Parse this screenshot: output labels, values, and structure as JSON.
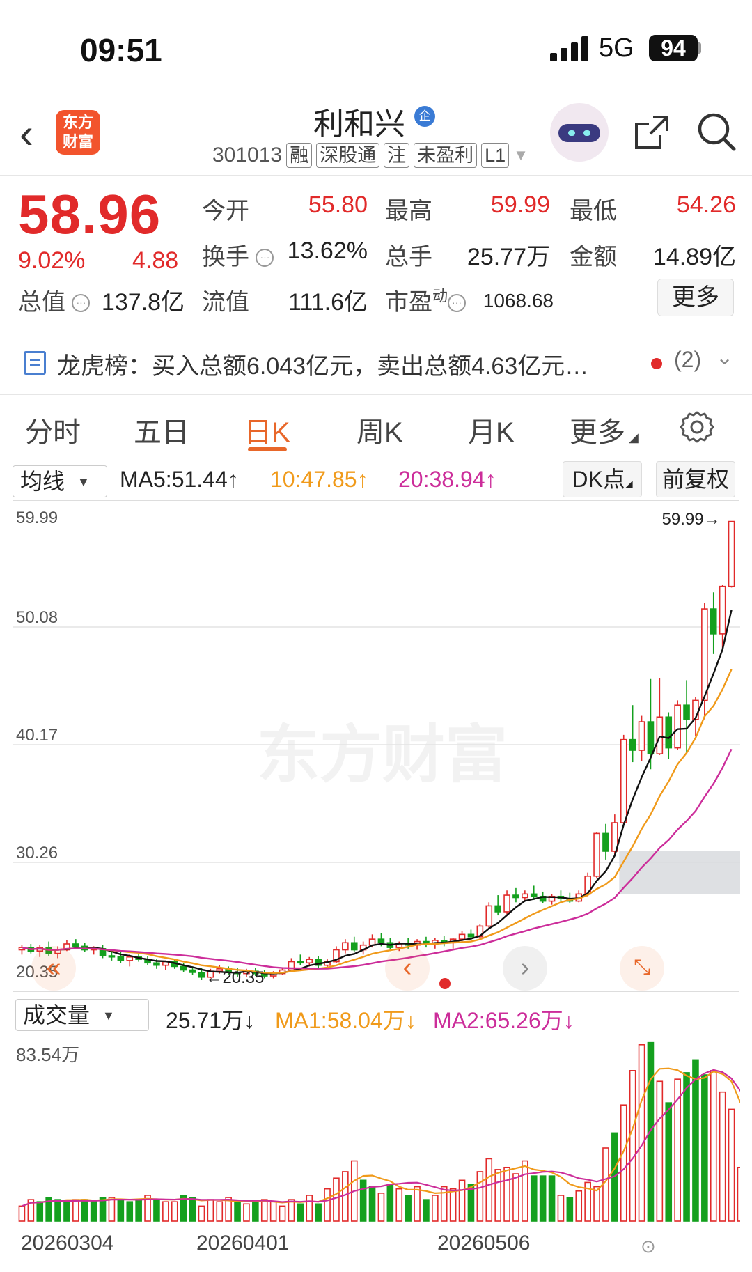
{
  "status_bar": {
    "time": "09:51",
    "network": "5G",
    "battery": "94"
  },
  "header": {
    "logo_text": "东方财富",
    "stock_name": "利和兴",
    "verified_badge": "企",
    "code": "301013",
    "tags": [
      "融",
      "深股通",
      "注",
      "未盈利",
      "L1"
    ]
  },
  "quote": {
    "price": "58.96",
    "change_pct": "9.02%",
    "change": "4.88",
    "open_label": "今开",
    "open": "55.80",
    "high_label": "最高",
    "high": "59.99",
    "low_label": "最低",
    "low": "54.26",
    "turnover_label": "换手",
    "turnover": "13.62%",
    "volume_label": "总手",
    "volume": "25.77万",
    "amount_label": "金额",
    "amount": "14.89亿",
    "mktcap_label": "总值",
    "mktcap": "137.8亿",
    "float_label": "流值",
    "float_cap": "111.6亿",
    "pe_label": "市盈",
    "pe_sup": "动",
    "pe": "1068.68",
    "more": "更多"
  },
  "dragon_tiger": {
    "text": "龙虎榜：买入总额6.043亿元，卖出总额4.63亿元…",
    "count": "(2)"
  },
  "tabs": [
    "分时",
    "五日",
    "日K",
    "周K",
    "月K",
    "更多"
  ],
  "active_tab": "日K",
  "ma_bar": {
    "selector": "均线",
    "ma5": "MA5:51.44↑",
    "ma10": "10:47.85↑",
    "ma20": "20:38.94↑",
    "dk_button": "DK点",
    "adjust_button": "前复权"
  },
  "colors": {
    "up": "#e12a2a",
    "down": "#14a01e",
    "ma5": "#111111",
    "ma10": "#f09a1a",
    "ma20": "#cc2d9a",
    "accent": "#e8672a"
  },
  "vol_bar": {
    "selector": "成交量",
    "value": "25.71万↓",
    "ma1": "MA1:58.04万↓",
    "ma2": "MA2:65.26万↓"
  },
  "watermark": "东方财富",
  "chart_data": {
    "type": "candlestick",
    "y_ticks": [
      "59.99",
      "50.08",
      "40.17",
      "30.26",
      "20.35"
    ],
    "ylim": [
      20.35,
      59.99
    ],
    "max_marker": "59.99→",
    "min_marker": "←20.35",
    "vol_max_label": "83.54万",
    "x_labels": [
      "20260304",
      "20260401",
      "20260506"
    ],
    "candles": [
      [
        22.9,
        23.3,
        22.5,
        23.1
      ],
      [
        23.1,
        23.4,
        22.6,
        22.8
      ],
      [
        22.8,
        23.3,
        22.3,
        23.1
      ],
      [
        23.1,
        23.6,
        22.4,
        22.6
      ],
      [
        22.6,
        23.2,
        22.2,
        22.9
      ],
      [
        22.9,
        23.7,
        22.8,
        23.4
      ],
      [
        23.4,
        23.8,
        23.0,
        23.2
      ],
      [
        23.2,
        23.5,
        22.7,
        22.9
      ],
      [
        22.9,
        23.2,
        22.5,
        23.0
      ],
      [
        23.0,
        23.3,
        22.2,
        22.4
      ],
      [
        22.4,
        22.8,
        22.0,
        22.3
      ],
      [
        22.3,
        22.7,
        21.8,
        22.0
      ],
      [
        22.0,
        22.5,
        21.5,
        22.3
      ],
      [
        22.3,
        22.6,
        21.9,
        22.1
      ],
      [
        22.1,
        22.4,
        21.6,
        21.8
      ],
      [
        21.8,
        22.1,
        21.3,
        21.6
      ],
      [
        21.6,
        22.0,
        21.2,
        21.9
      ],
      [
        21.9,
        22.1,
        21.3,
        21.5
      ],
      [
        21.5,
        21.8,
        21.0,
        21.2
      ],
      [
        21.2,
        21.5,
        20.8,
        21.0
      ],
      [
        21.0,
        21.4,
        20.35,
        20.6
      ],
      [
        20.6,
        21.3,
        20.5,
        21.1
      ],
      [
        21.1,
        21.6,
        20.9,
        21.3
      ],
      [
        21.3,
        21.5,
        20.8,
        21.0
      ],
      [
        21.0,
        21.4,
        20.6,
        20.9
      ],
      [
        20.9,
        21.3,
        20.6,
        21.1
      ],
      [
        21.1,
        21.4,
        20.7,
        20.9
      ],
      [
        20.9,
        21.2,
        20.5,
        20.7
      ],
      [
        20.7,
        21.1,
        20.5,
        20.9
      ],
      [
        20.9,
        21.4,
        20.8,
        21.2
      ],
      [
        21.2,
        22.2,
        21.1,
        21.9
      ],
      [
        21.9,
        22.5,
        21.6,
        21.8
      ],
      [
        21.8,
        22.3,
        21.5,
        22.1
      ],
      [
        22.1,
        22.4,
        21.4,
        21.6
      ],
      [
        21.6,
        22.1,
        21.3,
        21.9
      ],
      [
        21.9,
        23.2,
        21.8,
        22.9
      ],
      [
        22.9,
        23.8,
        22.6,
        23.5
      ],
      [
        23.5,
        24.0,
        22.7,
        22.9
      ],
      [
        22.9,
        23.6,
        22.5,
        23.3
      ],
      [
        23.3,
        24.2,
        23.1,
        23.8
      ],
      [
        23.8,
        24.3,
        23.2,
        23.5
      ],
      [
        23.5,
        23.9,
        22.8,
        23.1
      ],
      [
        23.1,
        23.6,
        22.8,
        23.4
      ],
      [
        23.4,
        23.9,
        23.0,
        23.3
      ],
      [
        23.3,
        23.8,
        22.9,
        23.6
      ],
      [
        23.6,
        24.0,
        23.1,
        23.4
      ],
      [
        23.4,
        23.9,
        23.0,
        23.7
      ],
      [
        23.7,
        24.1,
        23.2,
        23.5
      ],
      [
        23.5,
        23.9,
        23.0,
        23.8
      ],
      [
        23.8,
        24.5,
        23.6,
        24.2
      ],
      [
        24.2,
        24.6,
        23.7,
        24.0
      ],
      [
        24.0,
        25.1,
        23.8,
        24.9
      ],
      [
        24.9,
        26.9,
        24.7,
        26.6
      ],
      [
        26.6,
        27.5,
        25.8,
        26.1
      ],
      [
        26.1,
        27.9,
        25.9,
        27.5
      ],
      [
        27.5,
        28.1,
        26.9,
        27.3
      ],
      [
        27.3,
        27.9,
        27.0,
        27.6
      ],
      [
        27.6,
        28.3,
        27.1,
        27.4
      ],
      [
        27.4,
        27.8,
        26.8,
        27.0
      ],
      [
        27.0,
        27.6,
        26.7,
        27.4
      ],
      [
        27.4,
        27.9,
        26.9,
        27.2
      ],
      [
        27.2,
        27.7,
        26.8,
        27.0
      ],
      [
        27.0,
        27.9,
        26.9,
        27.6
      ],
      [
        27.6,
        29.4,
        27.4,
        29.1
      ],
      [
        29.1,
        32.8,
        28.9,
        32.7
      ],
      [
        32.7,
        33.5,
        30.5,
        31.2
      ],
      [
        31.2,
        34.3,
        30.9,
        33.6
      ],
      [
        33.6,
        41.0,
        33.4,
        40.6
      ],
      [
        40.6,
        43.5,
        38.7,
        39.7
      ],
      [
        39.7,
        42.6,
        38.8,
        42.1
      ],
      [
        42.1,
        45.7,
        38.1,
        39.4
      ],
      [
        39.4,
        45.8,
        39.3,
        42.5
      ],
      [
        42.5,
        42.9,
        39.0,
        39.9
      ],
      [
        39.9,
        43.9,
        39.7,
        43.5
      ],
      [
        43.5,
        45.6,
        39.5,
        42.3
      ],
      [
        42.3,
        44.2,
        40.9,
        43.9
      ],
      [
        43.9,
        52.1,
        42.3,
        51.6
      ],
      [
        51.6,
        53.0,
        47.8,
        49.5
      ],
      [
        49.5,
        53.6,
        48.1,
        53.5
      ],
      [
        53.5,
        58.9,
        53.4,
        58.96
      ]
    ],
    "volumes": [
      7,
      10,
      9,
      11,
      10,
      9,
      10,
      10,
      9,
      11,
      11,
      10,
      9,
      10,
      12,
      10,
      9,
      9,
      12,
      11,
      7,
      10,
      9,
      11,
      9,
      8,
      9,
      10,
      9,
      7,
      10,
      8,
      12,
      8,
      15,
      20,
      23,
      28,
      19,
      16,
      13,
      17,
      15,
      12,
      16,
      10,
      12,
      16,
      15,
      19,
      17,
      23,
      29,
      24,
      25,
      22,
      28,
      21,
      21,
      21,
      12,
      11,
      14,
      18,
      16,
      34,
      41,
      54,
      70,
      82,
      83,
      65,
      55,
      66,
      69,
      75,
      68,
      70,
      60,
      52,
      25
    ],
    "volume_colors": [
      "r",
      "r",
      "g",
      "g",
      "g",
      "g",
      "r",
      "g",
      "g",
      "g",
      "r",
      "g",
      "g",
      "g",
      "r",
      "g",
      "r",
      "r",
      "g",
      "g",
      "r",
      "r",
      "r",
      "r",
      "g",
      "r",
      "g",
      "r",
      "r",
      "r",
      "r",
      "g",
      "r",
      "g",
      "r",
      "r",
      "r",
      "r",
      "g",
      "g",
      "r",
      "g",
      "r",
      "g",
      "r",
      "g",
      "r",
      "r",
      "r",
      "r",
      "g",
      "r",
      "r",
      "r",
      "r",
      "r",
      "r",
      "g",
      "g",
      "g",
      "r",
      "g",
      "r",
      "r",
      "r",
      "r",
      "g",
      "r",
      "r",
      "r",
      "g",
      "r",
      "g",
      "r",
      "g",
      "g",
      "g",
      "r",
      "r",
      "r",
      "r"
    ]
  }
}
